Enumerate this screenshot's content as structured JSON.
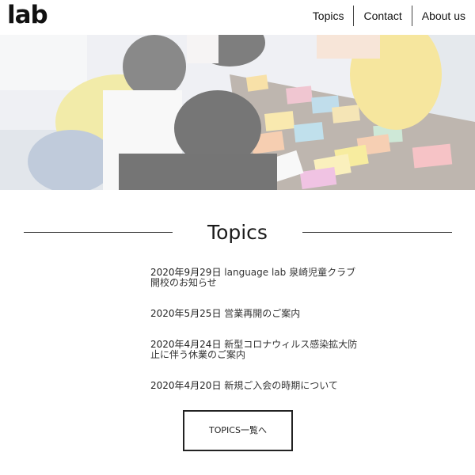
{
  "header": {
    "logo": "lab",
    "nav": [
      {
        "label": "Topics"
      },
      {
        "label": "Contact"
      },
      {
        "label": "About us"
      }
    ]
  },
  "hero": {
    "description_icon": "classroom-photo"
  },
  "topics": {
    "heading": "Topics",
    "items": [
      {
        "date": "2020年9月29日",
        "title": "language lab 泉崎児童クラブ 開校のお知らせ"
      },
      {
        "date": "2020年5月25日",
        "title": "営業再開のご案内"
      },
      {
        "date": "2020年4月24日",
        "title": "新型コロナウィルス感染拡大防止に伴う休業のご案内"
      },
      {
        "date": "2020年4月20日",
        "title": "新規ご入会の時期について"
      }
    ],
    "more_button": "TOPICS一覧へ"
  }
}
